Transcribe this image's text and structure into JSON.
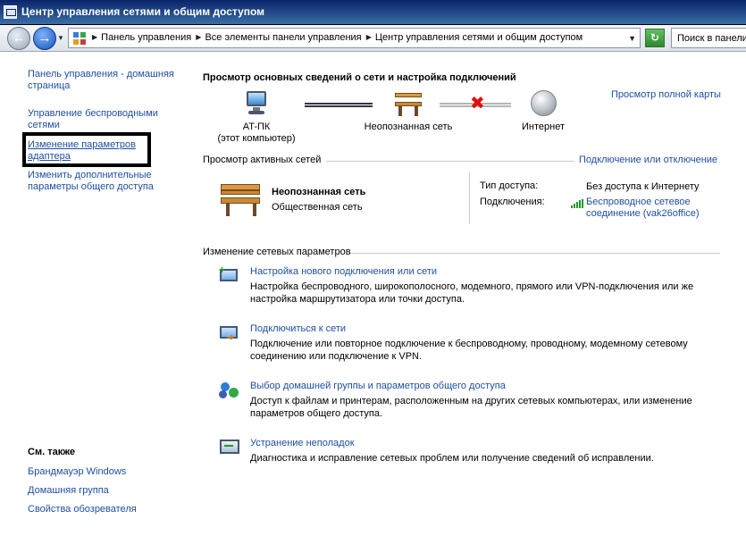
{
  "window": {
    "title": "Центр управления сетями и общим доступом"
  },
  "navbar": {
    "breadcrumbs": [
      "Панель управления",
      "Все элементы панели управления",
      "Центр управления сетями и общим доступом"
    ],
    "search_placeholder": "Поиск в панели"
  },
  "left_pane": {
    "links": [
      "Панель управления - домашняя страница",
      "Управление беспроводными сетями",
      "Изменение параметров адаптера",
      "Изменить дополнительные параметры общего доступа"
    ],
    "see_also_title": "См. также",
    "see_also_links": [
      "Брандмауэр Windows",
      "Домашняя группа",
      "Свойства обозревателя"
    ]
  },
  "main": {
    "title": "Просмотр основных сведений о сети и настройка подключений",
    "full_map_link": "Просмотр полной карты",
    "map": {
      "computer_name": "AT-ПК",
      "computer_sub": "(этот компьютер)",
      "network_name": "Неопознанная сеть",
      "internet": "Интернет"
    },
    "active_header": "Просмотр активных сетей",
    "connect_link": "Подключение или отключение",
    "active_network": {
      "name": "Неопознанная сеть",
      "type": "Общественная сеть",
      "access_label": "Тип доступа:",
      "access_value": "Без доступа к Интернету",
      "connections_label": "Подключения:",
      "connection_link": "Беспроводное сетевое соединение (vak26office)"
    },
    "change_header": "Изменение сетевых параметров",
    "tasks": [
      {
        "link": "Настройка нового подключения или сети",
        "desc": "Настройка беспроводного, широкополосного, модемного, прямого или VPN-подключения или же настройка маршрутизатора или точки доступа.",
        "icon": "new-connection-icon"
      },
      {
        "link": "Подключиться к сети",
        "desc": "Подключение или повторное подключение к беспроводному, проводному, модемному сетевому соединению или подключение к VPN.",
        "icon": "connect-network-icon"
      },
      {
        "link": "Выбор домашней группы и параметров общего доступа",
        "desc": "Доступ к файлам и принтерам, расположенным на других сетевых компьютерах, или изменение параметров общего доступа.",
        "icon": "homegroup-icon"
      },
      {
        "link": "Устранение неполадок",
        "desc": "Диагностика и исправление сетевых проблем или получение сведений об исправлении.",
        "icon": "troubleshoot-icon"
      }
    ]
  },
  "colors": {
    "link": "#1f4fa0",
    "title_bar": "#0a246a",
    "error_x": "#e01010"
  }
}
